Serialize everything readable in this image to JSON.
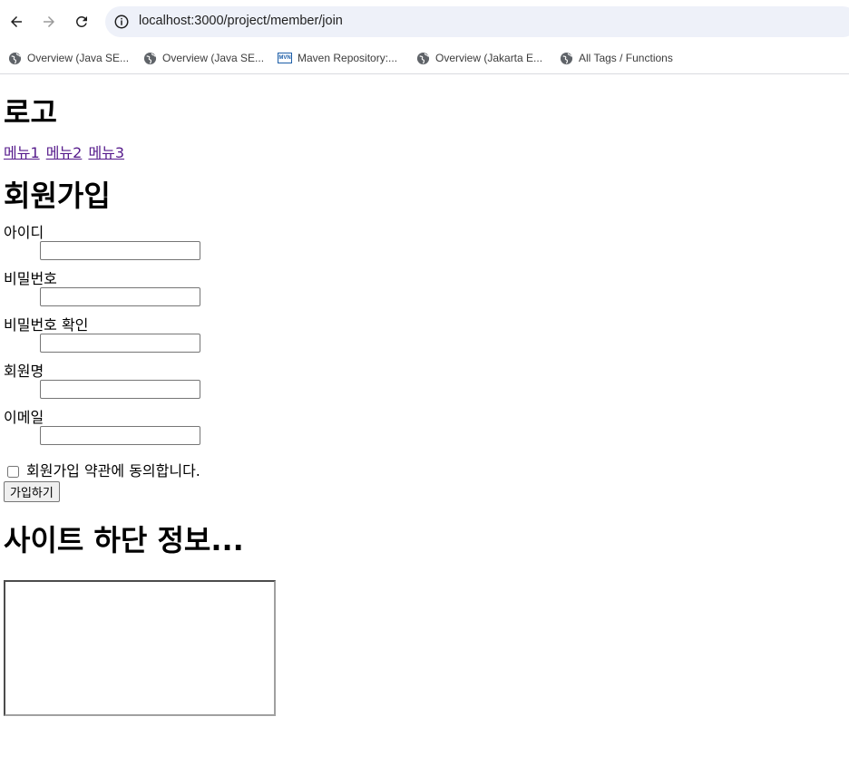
{
  "browser": {
    "url": "localhost:3000/project/member/join",
    "bookmarks": [
      {
        "label": "Overview (Java SE...",
        "icon": "globe-icon"
      },
      {
        "label": "Overview (Java SE...",
        "icon": "globe-icon"
      },
      {
        "label": "Maven Repository:...",
        "icon": "maven-icon"
      },
      {
        "label": "Overview (Jakarta E...",
        "icon": "globe-icon"
      },
      {
        "label": "All Tags / Functions",
        "icon": "globe-icon"
      }
    ],
    "maven_badge": "MVN"
  },
  "header": {
    "logo": "로고",
    "menu": [
      "메뉴1",
      "메뉴2",
      "메뉴3"
    ]
  },
  "form": {
    "title": "회원가입",
    "fields": [
      {
        "label": "아이디",
        "value": ""
      },
      {
        "label": "비밀번호",
        "value": ""
      },
      {
        "label": "비밀번호 확인",
        "value": ""
      },
      {
        "label": "회원명",
        "value": ""
      },
      {
        "label": "이메일",
        "value": ""
      }
    ],
    "agree_label": "회원가입 약관에 동의합니다.",
    "agree_checked": false,
    "submit_label": "가입하기"
  },
  "footer": {
    "title": "사이트 하단 정보..."
  },
  "colors": {
    "visited_link": "#551a8b",
    "omnibox_bg": "#eef1f9"
  }
}
